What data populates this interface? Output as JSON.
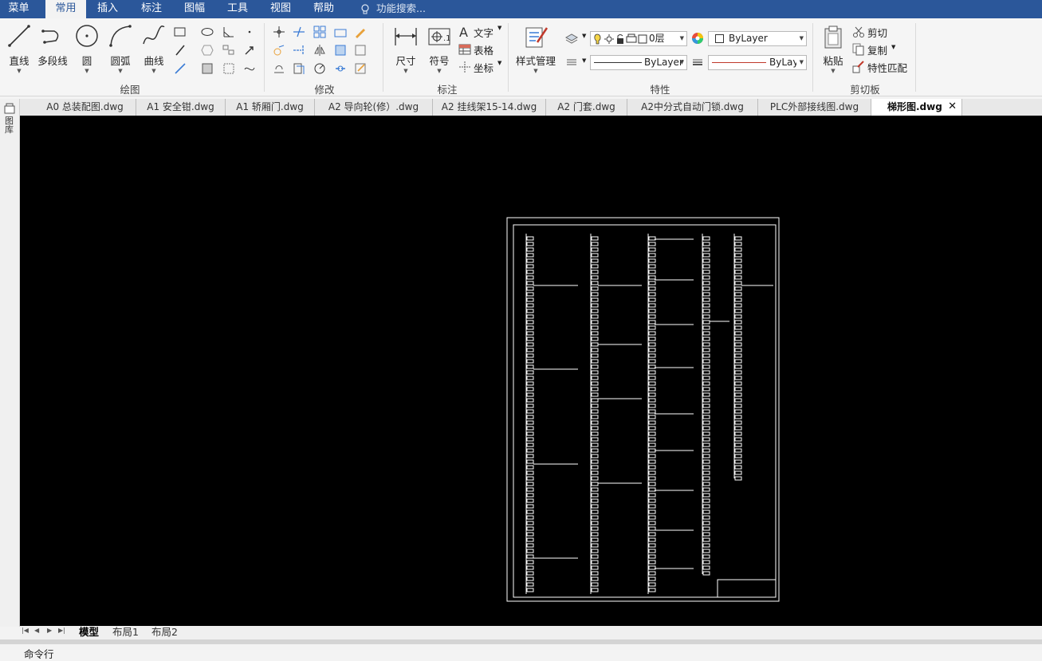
{
  "menu": {
    "items": [
      "菜单",
      "常用",
      "插入",
      "标注",
      "图幅",
      "工具",
      "视图",
      "帮助"
    ],
    "active": "常用",
    "search_placeholder": "功能搜索..."
  },
  "ribbon": {
    "groups": {
      "draw": "绘图",
      "modify": "修改",
      "annotate": "标注",
      "properties": "特性",
      "clipboard": "剪切板"
    },
    "draw": {
      "line": "直线",
      "polyline": "多段线",
      "circle": "圆",
      "arc": "圆弧",
      "curve": "曲线"
    },
    "annotate": {
      "dimension": "尺寸",
      "symbol": "符号",
      "text": "文字",
      "table": "表格",
      "coordinate": "坐标"
    },
    "properties": {
      "style_manager": "样式管理",
      "layer": "0层",
      "color": "ByLayer",
      "linetype": "ByLayer",
      "lineweight": "ByLaye",
      "accent_red": "#c0392b"
    },
    "clipboard": {
      "paste": "粘贴",
      "cut": "剪切",
      "copy": "复制",
      "match": "特性匹配"
    }
  },
  "tabs": [
    "A0 总装配图.dwg",
    "A1 安全钳.dwg",
    "A1 轿厢门.dwg",
    "A2 导向轮(修）.dwg",
    "A2 挂线架15-14.dwg",
    "A2 门套.dwg",
    "A2中分式自动门锁.dwg",
    "PLC外部接线图.dwg",
    "梯形图.dwg"
  ],
  "active_tab": "梯形图.dwg",
  "sidebar_label": "图库",
  "layout_tabs": [
    "模型",
    "布局1",
    "布局2"
  ],
  "active_layout": "模型",
  "command_label": "命令行"
}
